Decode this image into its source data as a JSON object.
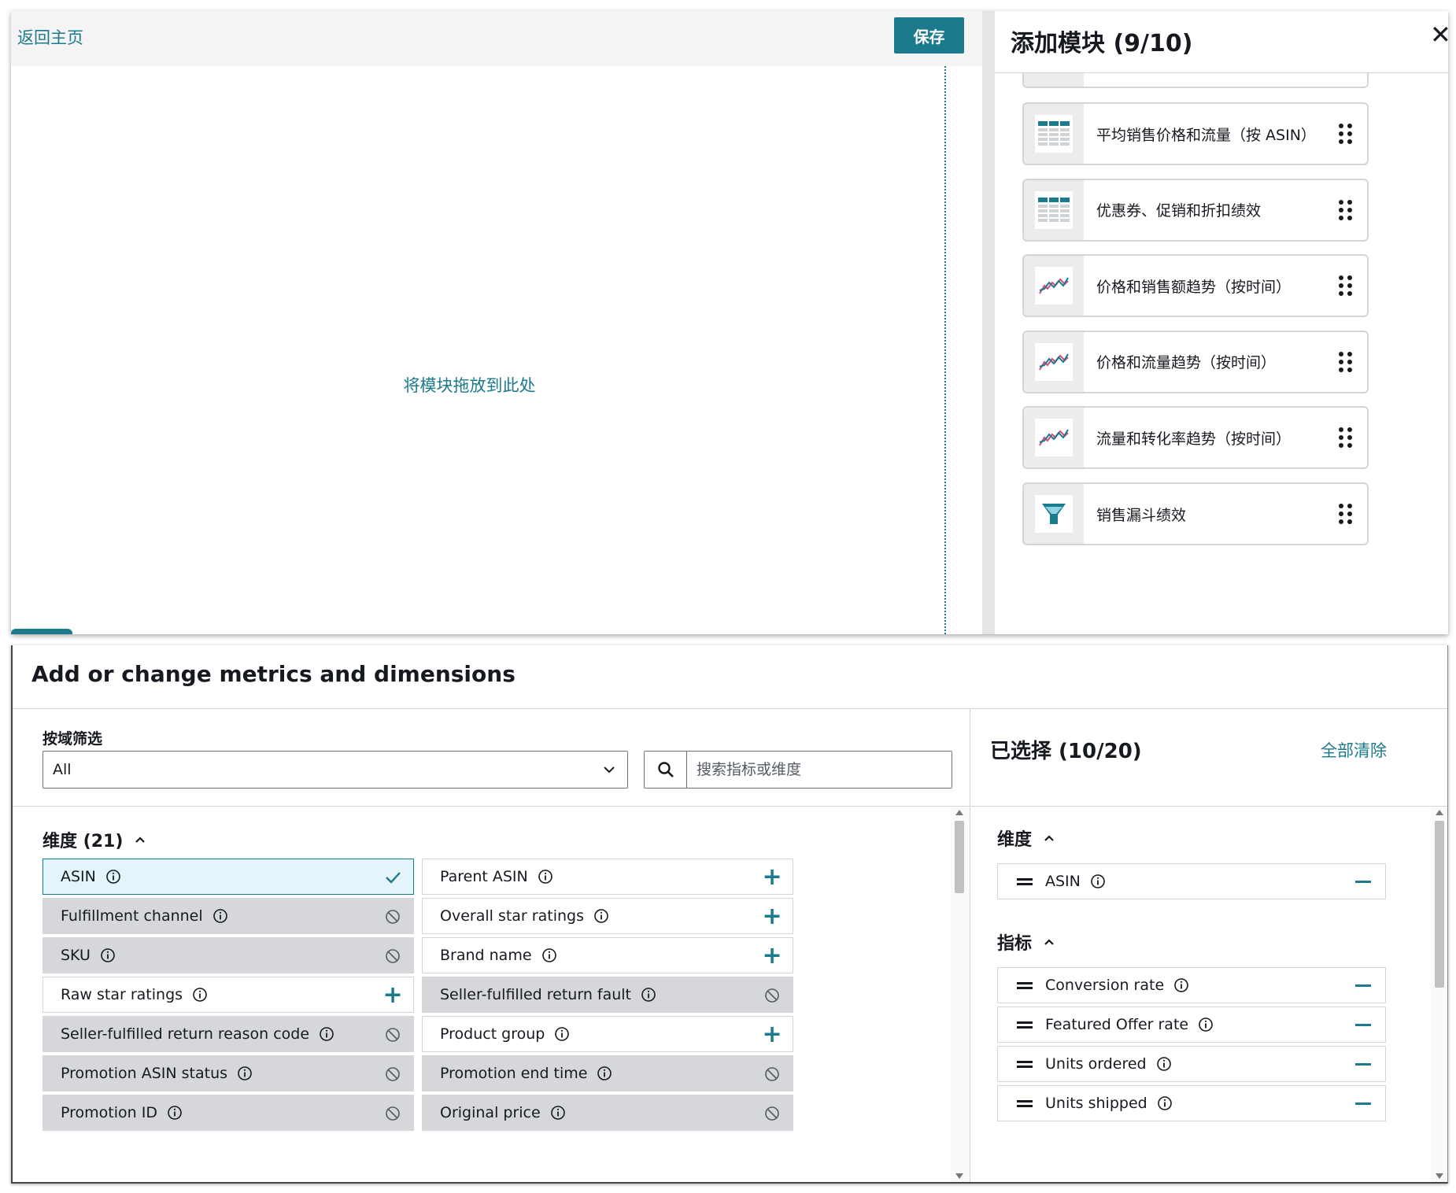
{
  "top": {
    "back_link": "返回主页",
    "save_label": "保存",
    "drop_hint": "将模块拖放到此处",
    "panel_title": "添加模块 (9/10)",
    "close_glyph": "✕",
    "modules": [
      {
        "label": "平均销售价格和流量（按 ASIN）",
        "icon": "table-icon"
      },
      {
        "label": "优惠券、促销和折扣绩效",
        "icon": "table-icon"
      },
      {
        "label": "价格和销售额趋势（按时间）",
        "icon": "line-chart-icon"
      },
      {
        "label": "价格和流量趋势（按时间）",
        "icon": "line-chart-icon"
      },
      {
        "label": "流量和转化率趋势（按时间）",
        "icon": "line-chart-icon"
      },
      {
        "label": "销售漏斗绩效",
        "icon": "funnel-icon"
      }
    ]
  },
  "dialog": {
    "title": "Add or change metrics and dimensions",
    "filter_label": "按域筛选",
    "filter_value": "All",
    "search_placeholder": "搜索指标或维度",
    "dimensions_heading": "维度 (21)",
    "dimensions": [
      {
        "label": "ASIN",
        "state": "selected"
      },
      {
        "label": "Parent ASIN",
        "state": "available"
      },
      {
        "label": "Fulfillment channel",
        "state": "disabled"
      },
      {
        "label": "Overall star ratings",
        "state": "available"
      },
      {
        "label": "SKU",
        "state": "disabled"
      },
      {
        "label": "Brand name",
        "state": "available"
      },
      {
        "label": "Raw star ratings",
        "state": "available"
      },
      {
        "label": "Seller-fulfilled return fault",
        "state": "disabled"
      },
      {
        "label": "Seller-fulfilled return reason code",
        "state": "disabled"
      },
      {
        "label": "Product group",
        "state": "available"
      },
      {
        "label": "Promotion ASIN status",
        "state": "disabled"
      },
      {
        "label": "Promotion end time",
        "state": "disabled"
      },
      {
        "label": "Promotion ID",
        "state": "disabled"
      },
      {
        "label": "Original price",
        "state": "disabled"
      }
    ],
    "selected_heading": "已选择 (10/20)",
    "clear_all": "全部清除",
    "selected_dimensions_heading": "维度",
    "selected_dimensions": [
      "ASIN"
    ],
    "selected_metrics_heading": "指标",
    "selected_metrics": [
      "Conversion rate",
      "Featured Offer rate",
      "Units ordered",
      "Units shipped"
    ]
  },
  "colors": {
    "accent": "#1b7a8c",
    "selected_bg": "#e3f5fa",
    "disabled_bg": "#d5d7da",
    "chart_pink": "#e0457b"
  }
}
